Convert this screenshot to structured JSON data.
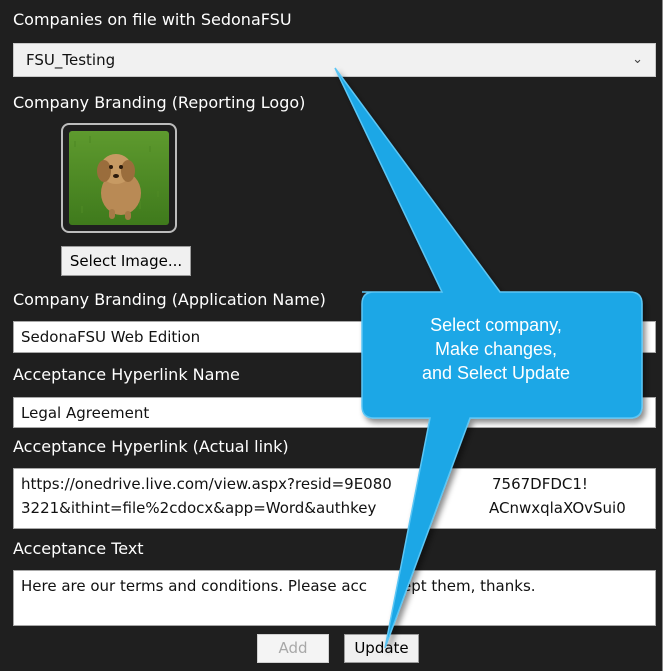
{
  "companies": {
    "label": "Companies on file with SedonaFSU",
    "selected": "FSU_Testing",
    "chevron_icon": "chevron-down-icon"
  },
  "reporting_logo": {
    "label": "Company Branding (Reporting Logo)",
    "image_icon": "dog-photo",
    "select_button": "Select Image..."
  },
  "app_name": {
    "label": "Company Branding (Application Name)",
    "value": "SedonaFSU Web Edition"
  },
  "hyperlink_name": {
    "label": "Acceptance Hyperlink Name",
    "value": "Legal Agreement"
  },
  "hyperlink_url": {
    "label": "Acceptance Hyperlink (Actual link)",
    "line1": "https://onedrive.live.com/view.aspx?resid=9E080",
    "line1_end": "7567DFDC1!",
    "line2": "3221&ithint=file%2cdocx&app=Word&authkey",
    "line2_end": "ACnwxqlaXOvSui0"
  },
  "acceptance_text": {
    "label": "Acceptance Text",
    "value_start": "Here are our terms and conditions. Please acc",
    "value_end": "ept them, thanks."
  },
  "buttons": {
    "add": "Add",
    "update": "Update"
  },
  "callout": {
    "line1": "Select company,",
    "line2": "Make changes,",
    "line3": "and Select Update",
    "color": "#1aa7e6"
  }
}
